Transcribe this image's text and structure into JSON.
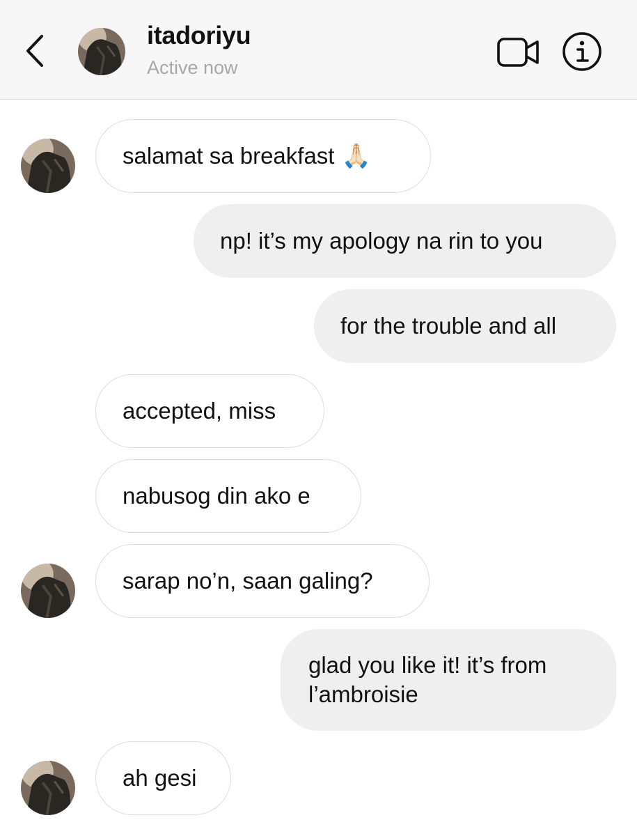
{
  "header": {
    "username": "itadoriyu",
    "status": "Active now",
    "back_icon": "chevron-left-icon",
    "video_icon": "video-camera-icon",
    "info_icon": "info-icon"
  },
  "messages": [
    {
      "sender": "them",
      "text": "salamat sa breakfast",
      "emoji": "🙏🏻"
    },
    {
      "sender": "me",
      "text": "np! it’s my apology na rin to you"
    },
    {
      "sender": "me",
      "text": "for the trouble and all"
    },
    {
      "sender": "them",
      "text": "accepted, miss"
    },
    {
      "sender": "them",
      "text": "nabusog din ako e"
    },
    {
      "sender": "them",
      "text": "sarap no’n, saan galing?"
    },
    {
      "sender": "me",
      "text": "glad you like it! it’s from l’ambroisie"
    },
    {
      "sender": "them",
      "text": "ah gesi"
    }
  ],
  "colors": {
    "header_bg": "#f7f7f7",
    "sent_bubble": "#efefef",
    "received_border": "#dddddd",
    "status_text": "#a8a8a8"
  }
}
